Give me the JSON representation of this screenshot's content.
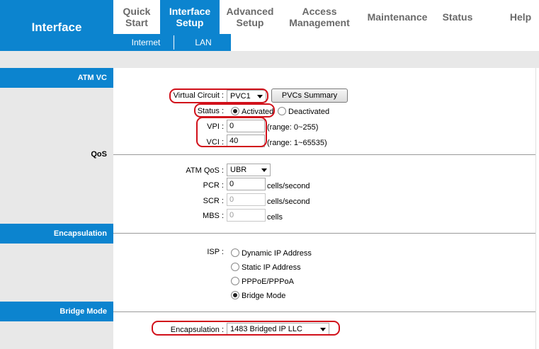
{
  "header": {
    "title": "Interface",
    "tabs": [
      {
        "label": "Quick Start"
      },
      {
        "label": "Interface Setup"
      },
      {
        "label": "Advanced Setup"
      },
      {
        "label": "Access Management"
      },
      {
        "label": "Maintenance"
      },
      {
        "label": "Status"
      },
      {
        "label": "Help"
      }
    ],
    "active_tab": "Interface Setup",
    "subtabs": [
      {
        "label": "Internet"
      },
      {
        "label": "LAN"
      }
    ]
  },
  "sections": {
    "atm_vc": "ATM VC",
    "qos": "QoS",
    "encapsulation": "Encapsulation",
    "bridge_mode": "Bridge Mode"
  },
  "atm": {
    "virtual_circuit_label": "Virtual Circuit :",
    "virtual_circuit_value": "PVC1",
    "pvcs_summary_button": "PVCs Summary",
    "status_label": "Status :",
    "status_activated": "Activated",
    "status_deactivated": "Deactivated",
    "vpi_label": "VPI :",
    "vpi_value": "0",
    "vpi_range": "(range: 0~255)",
    "vci_label": "VCI :",
    "vci_value": "40",
    "vci_range": "(range: 1~65535)"
  },
  "qos": {
    "atm_qos_label": "ATM QoS :",
    "atm_qos_value": "UBR",
    "pcr_label": "PCR :",
    "pcr_value": "0",
    "pcr_unit": "cells/second",
    "scr_label": "SCR :",
    "scr_value": "0",
    "scr_unit": "cells/second",
    "mbs_label": "MBS :",
    "mbs_value": "0",
    "mbs_unit": "cells"
  },
  "isp": {
    "label": "ISP :",
    "options": [
      "Dynamic IP Address",
      "Static IP Address",
      "PPPoE/PPPoA",
      "Bridge Mode"
    ],
    "selected": "Bridge Mode"
  },
  "bridge": {
    "encapsulation_label": "Encapsulation :",
    "encapsulation_value": "1483 Bridged IP LLC"
  },
  "colors": {
    "brand_blue": "#0c84cf",
    "highlight_red": "#d1101a",
    "panel_grey": "#e8e8e8"
  }
}
